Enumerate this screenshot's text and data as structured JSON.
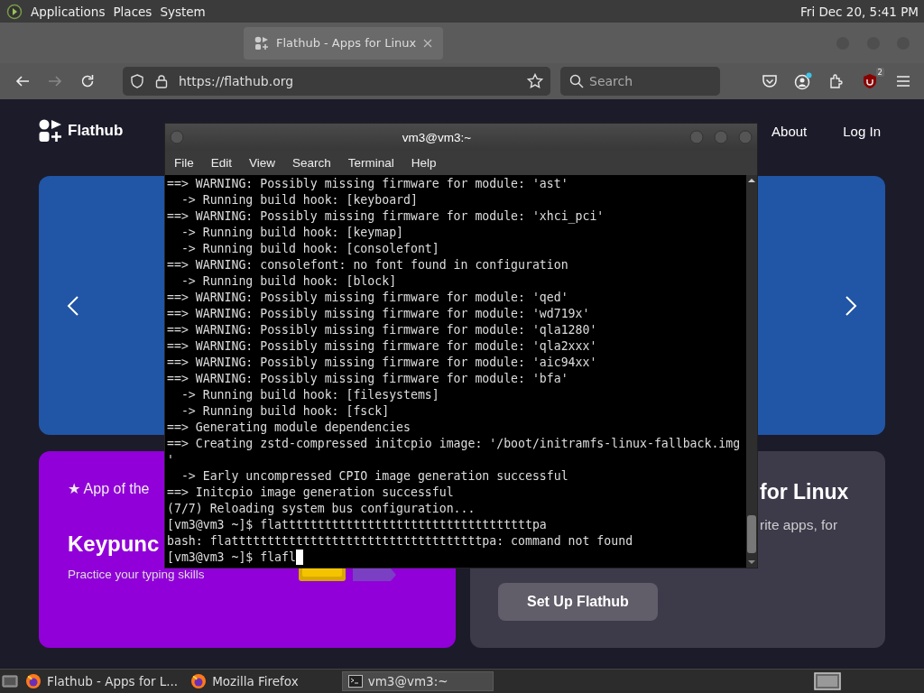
{
  "top_panel": {
    "menus": [
      "Applications",
      "Places",
      "System"
    ],
    "clock": "Fri Dec 20,  5:41 PM"
  },
  "browser": {
    "tab": {
      "title": "Flathub - Apps for Linux",
      "selected": true
    },
    "back_disabled": false,
    "forward_disabled": true,
    "url": "https://flathub.org",
    "search": {
      "placeholder": "Search"
    },
    "ublock_badge": "2",
    "account_notice": true
  },
  "site": {
    "logo": "Flathub",
    "nav": [
      "About",
      "Log In"
    ],
    "app_of_day": {
      "label": "★ App of the",
      "name": "Keypunc",
      "summary": "Practice your typing skills"
    },
    "setup": {
      "title": "for Linux",
      "text": "rite apps, for",
      "button": "Set Up Flathub"
    }
  },
  "terminal": {
    "title": "vm3@vm3:~",
    "menu": [
      "File",
      "Edit",
      "View",
      "Search",
      "Terminal",
      "Help"
    ],
    "lines": [
      "==> WARNING: Possibly missing firmware for module: 'ast'",
      "  -> Running build hook: [keyboard]",
      "==> WARNING: Possibly missing firmware for module: 'xhci_pci'",
      "  -> Running build hook: [keymap]",
      "  -> Running build hook: [consolefont]",
      "==> WARNING: consolefont: no font found in configuration",
      "  -> Running build hook: [block]",
      "==> WARNING: Possibly missing firmware for module: 'qed'",
      "==> WARNING: Possibly missing firmware for module: 'wd719x'",
      "==> WARNING: Possibly missing firmware for module: 'qla1280'",
      "==> WARNING: Possibly missing firmware for module: 'qla2xxx'",
      "==> WARNING: Possibly missing firmware for module: 'aic94xx'",
      "==> WARNING: Possibly missing firmware for module: 'bfa'",
      "  -> Running build hook: [filesystems]",
      "  -> Running build hook: [fsck]",
      "==> Generating module dependencies",
      "==> Creating zstd-compressed initcpio image: '/boot/initramfs-linux-fallback.img",
      "'",
      "  -> Early uncompressed CPIO image generation successful",
      "==> Initcpio image generation successful",
      "(7/7) Reloading system bus configuration...",
      "[vm3@vm3 ~]$ flatttttttttttttttttttttttttttttttttttpa",
      "bash: flatttttttttttttttttttttttttttttttttttpa: command not found"
    ],
    "prompt": {
      "text": "[vm3@vm3 ~]$ flafl",
      "cursor": true
    }
  },
  "taskbar": [
    {
      "label": "Flathub - Apps for L...",
      "kind": "firefox",
      "selected": false
    },
    {
      "label": "Mozilla Firefox",
      "kind": "firefox",
      "selected": false
    },
    {
      "label": "vm3@vm3:~",
      "kind": "terminal",
      "selected": true
    }
  ]
}
